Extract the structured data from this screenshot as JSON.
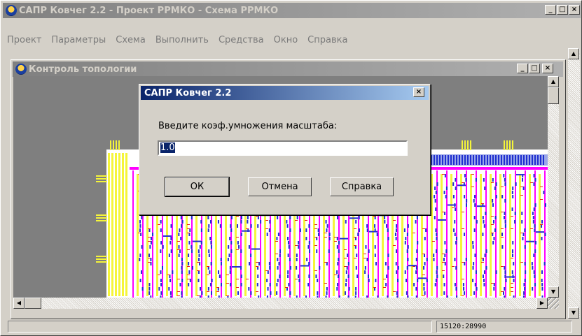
{
  "app": {
    "title": "САПР Ковчег 2.2 - Проект РРМКО - Схема РРМКО"
  },
  "menu": [
    "Проект",
    "Параметры",
    "Схема",
    "Выполнить",
    "Средства",
    "Окно",
    "Справка"
  ],
  "child": {
    "title": "Контроль топологии"
  },
  "dialog": {
    "title": "САПР Ковчег 2.2",
    "prompt": "Введите коэф.умножения масштаба:",
    "value": "1.0",
    "ok": "ОК",
    "cancel": "Отмена",
    "help": "Справка",
    "close_glyph": "×"
  },
  "status": {
    "coords": "15120:28990"
  },
  "colors": {
    "active_title": "#0a246a",
    "inactive_title": "#808080",
    "trace_blue": "#1f2fd0",
    "trace_magenta": "#ff00ff",
    "pad_yellow": "#f5f53a",
    "mark_red": "#e02020"
  }
}
